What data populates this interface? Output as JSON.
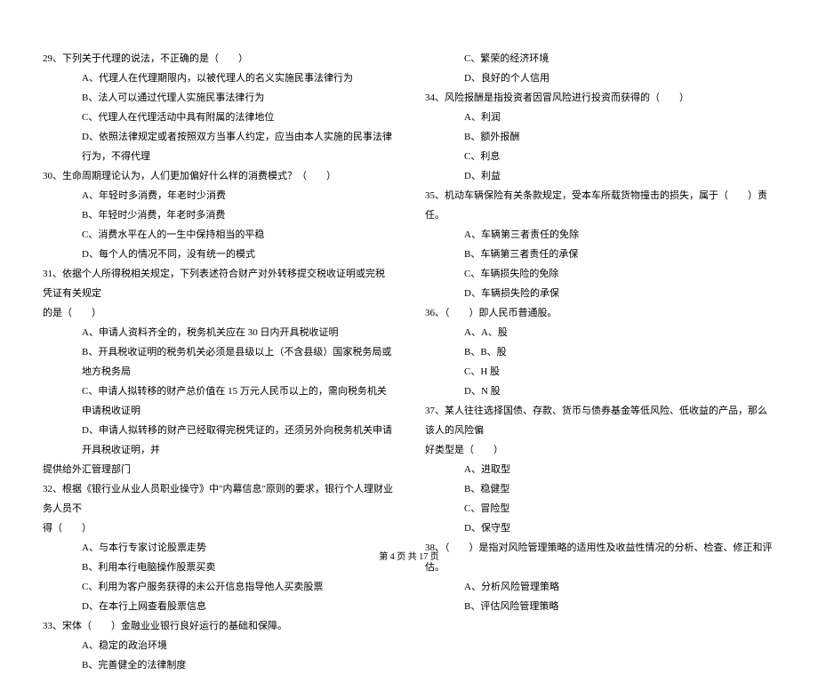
{
  "left_column": {
    "q29": {
      "stem": "29、下列关于代理的说法，不正确的是（　　）",
      "options": {
        "A": "A、代理人在代理期限内，以被代理人的名义实施民事法律行为",
        "B": "B、法人可以通过代理人实施民事法律行为",
        "C": "C、代理人在代理活动中具有附属的法律地位",
        "D": "D、依照法律规定或者按照双方当事人约定，应当由本人实施的民事法律行为，不得代理"
      }
    },
    "q30": {
      "stem": "30、生命周期理论认为，人们更加偏好什么样的消费模式？（　　）",
      "options": {
        "A": "A、年轻时多消费，年老时少消费",
        "B": "B、年轻时少消费，年老时多消费",
        "C": "C、消费水平在人的一生中保持相当的平稳",
        "D": "D、每个人的情况不同，没有统一的模式"
      }
    },
    "q31": {
      "stem_line1": "31、依据个人所得税相关规定，下列表述符合财产对外转移提交税收证明或完税凭证有关规定",
      "stem_line2": "的是（　　）",
      "options": {
        "A": "A、申请人资料齐全的，税务机关应在 30 日内开具税收证明",
        "B": "B、开具税收证明的税务机关必须是县级以上（不含县级）国家税务局或地方税务局",
        "C": "C、申请人拟转移的财产总价值在 15 万元人民币以上的，需向税务机关申请税收证明",
        "D_line1": "D、申请人拟转移的财产已经取得完税凭证的，还须另外向税务机关申请开具税收证明，并",
        "D_line2": "提供给外汇管理部门"
      }
    },
    "q32": {
      "stem_line1": "32、根据《银行业从业人员职业操守》中\"内幕信息\"原则的要求，银行个人理财业务人员不",
      "stem_line2": "得（　　）",
      "options": {
        "A": "A、与本行专家讨论股票走势",
        "B": "B、利用本行电脑操作股票买卖",
        "C": "C、利用为客户服务获得的未公开信息指导他人买卖股票",
        "D": "D、在本行上网查看股票信息"
      }
    },
    "q33": {
      "stem": "33、宋体（　　）金融业业银行良好运行的基础和保障。",
      "options": {
        "A": "A、稳定的政治环境",
        "B": "B、完善健全的法律制度"
      }
    }
  },
  "right_column": {
    "q33_cont": {
      "options": {
        "C": "C、繁荣的经济环境",
        "D": "D、良好的个人信用"
      }
    },
    "q34": {
      "stem": "34、风险报酬是指投资者因冒风险进行投资而获得的（　　）",
      "options": {
        "A": "A、利润",
        "B": "B、额外报酬",
        "C": "C、利息",
        "D": "D、利益"
      }
    },
    "q35": {
      "stem": "35、机动车辆保险有关条款规定，受本车所载货物撞击的损失，属于（　　）责任。",
      "options": {
        "A": "A、车辆第三者责任的免除",
        "B": "B、车辆第三者责任的承保",
        "C": "C、车辆损失险的免除",
        "D": "D、车辆损失险的承保"
      }
    },
    "q36": {
      "stem": "36、（　　）即人民币普通股。",
      "options": {
        "A": "A、A、股",
        "B": "B、B、股",
        "C": "C、H 股",
        "D": "D、N 股"
      }
    },
    "q37": {
      "stem_line1": "37、某人往往选择国债、存款、货币与债券基金等低风险、低收益的产品，那么该人的风险偏",
      "stem_line2": "好类型是（　　）",
      "options": {
        "A": "A、进取型",
        "B": "B、稳健型",
        "C": "C、冒险型",
        "D": "D、保守型"
      }
    },
    "q38": {
      "stem": "38、（　　）是指对风险管理策略的适用性及收益性情况的分析、检查、修正和评估。",
      "options": {
        "A": "A、分析风险管理策略",
        "B": "B、评估风险管理策略"
      }
    }
  },
  "footer": "第 4 页 共 17 页"
}
